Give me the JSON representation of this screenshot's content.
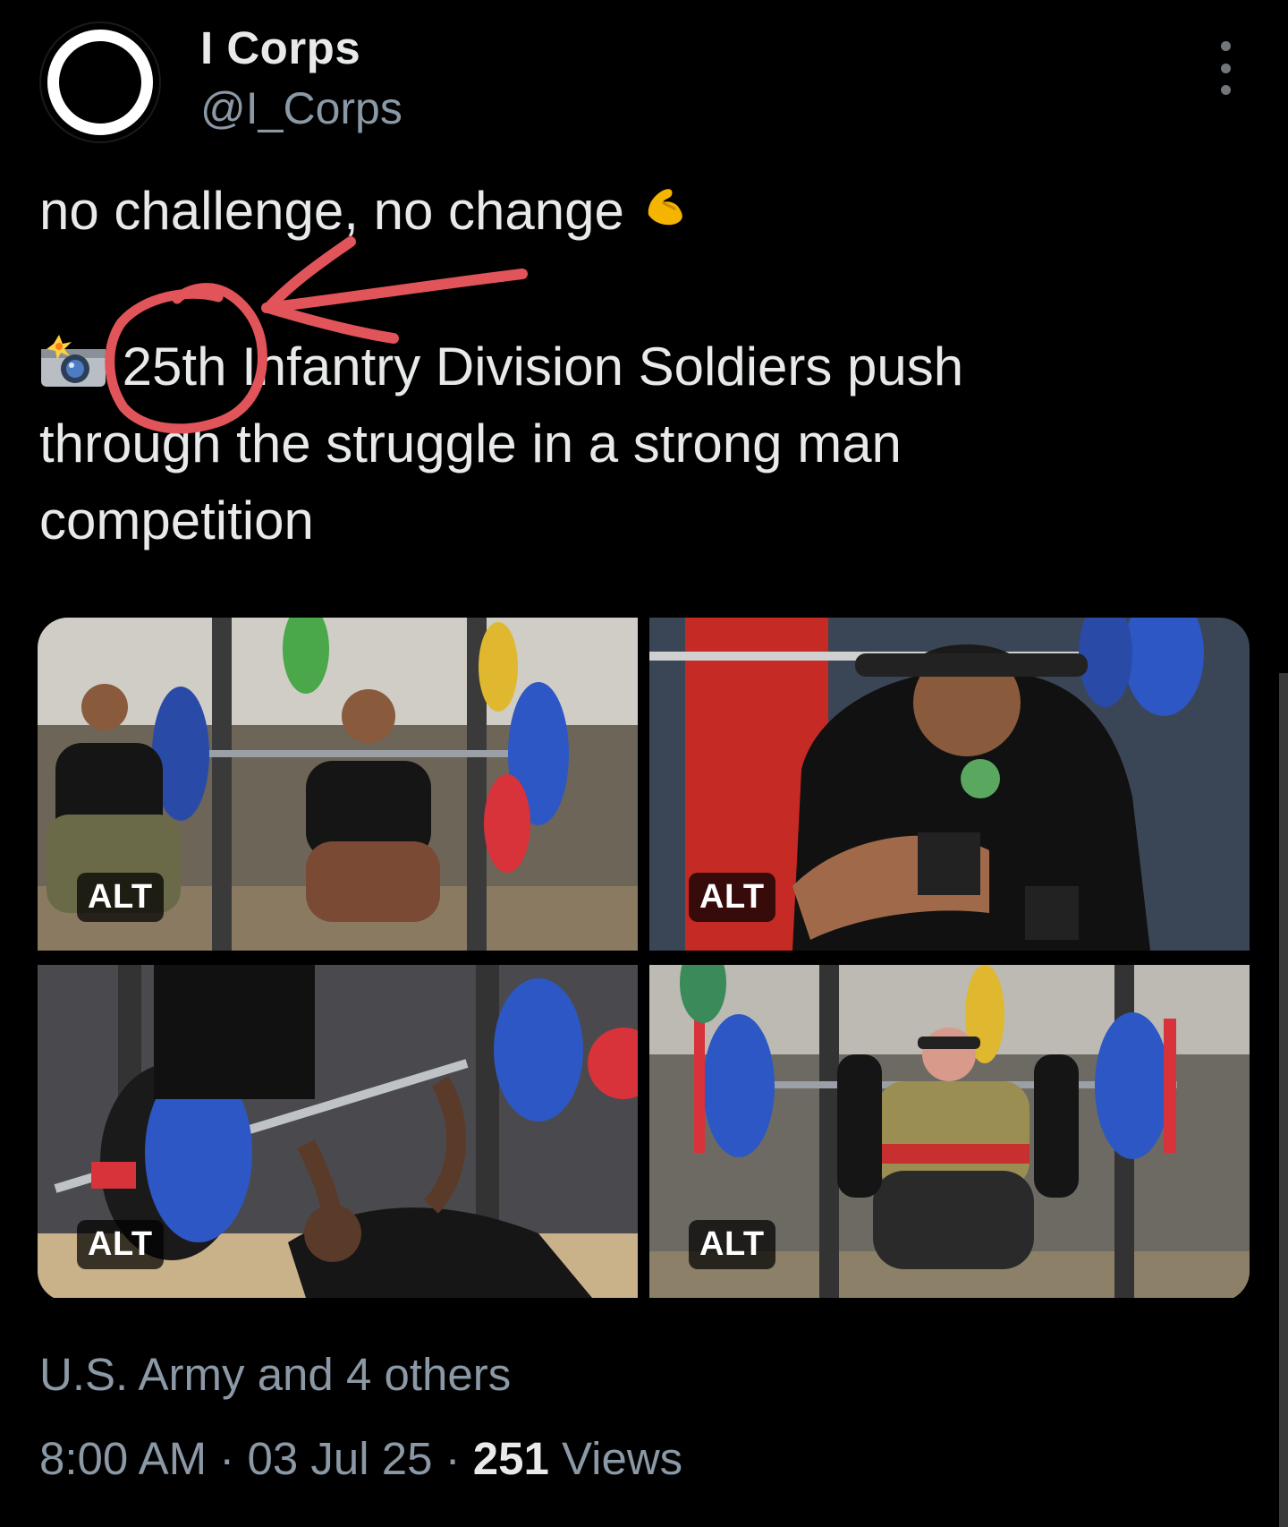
{
  "author": {
    "display_name": "I Corps",
    "handle": "@I_Corps"
  },
  "tweet": {
    "line1": "no challenge, no change",
    "flex_emoji": "flexed-biceps",
    "camera_emoji": "camera-with-flash",
    "line3_highlight": "25th",
    "line3_rest": " Infantry Division Soldiers push",
    "line4": "through the struggle in a strong man",
    "line5": "competition"
  },
  "media": {
    "alt_label": "ALT",
    "images": [
      {
        "alt_badge": "ALT"
      },
      {
        "alt_badge": "ALT"
      },
      {
        "alt_badge": "ALT"
      },
      {
        "alt_badge": "ALT"
      }
    ]
  },
  "annotation": {
    "color": "#e0545a"
  },
  "engagement": {
    "liked_by": "U.S. Army and 4 others"
  },
  "meta": {
    "time": "8:00 AM",
    "separator": "·",
    "date": "03 Jul 25",
    "views_count": "251",
    "views_label": "Views"
  },
  "colors": {
    "background": "#000000",
    "text_primary": "#e7e9ea",
    "text_secondary": "#8b98a5"
  }
}
